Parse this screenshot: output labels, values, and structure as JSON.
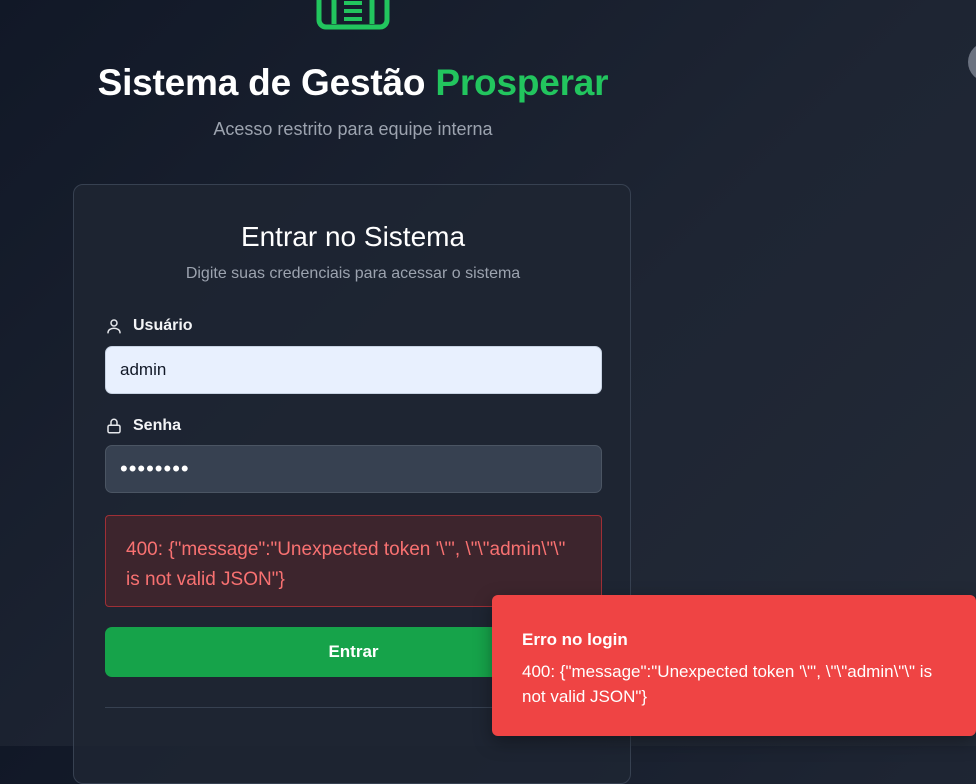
{
  "header": {
    "title_main": "Sistema de Gestão",
    "title_accent": "Prosperar",
    "subtitle": "Acesso restrito para equipe interna",
    "logo_icon": "building-logo-icon",
    "accent_color": "#22c55e"
  },
  "login_card": {
    "title": "Entrar no Sistema",
    "subtitle": "Digite suas credenciais para acessar o sistema",
    "username": {
      "label": "Usuário",
      "icon": "user-icon",
      "value": "admin"
    },
    "password": {
      "label": "Senha",
      "icon": "lock-icon",
      "value": "••••••••"
    },
    "error_message": "400: {\"message\":\"Unexpected token '\\\"', \\\"\\\"admin\\\"\\\" is not valid JSON\"}",
    "submit_label": "Entrar",
    "submit_color": "#16a34a"
  },
  "toast": {
    "title": "Erro no login",
    "message": "400: {\"message\":\"Unexpected token '\\\"', \\\"\\\"admin\\\"\\\" is not valid JSON\"}",
    "color": "#ef4444"
  }
}
